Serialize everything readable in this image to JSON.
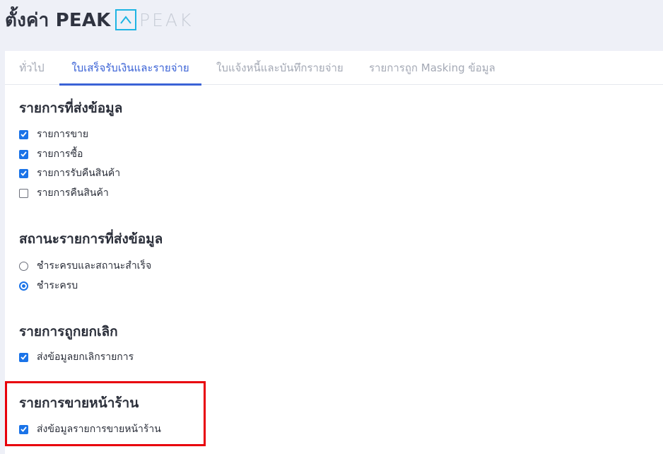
{
  "header": {
    "title": "ตั้งค่า PEAK",
    "logo_text": "PEAK",
    "logo_icon": "peak-logo-icon"
  },
  "tabs": [
    {
      "label": "ทั่วไป",
      "active": false
    },
    {
      "label": "ใบเสร็จรับเงินและรายจ่าย",
      "active": true
    },
    {
      "label": "ใบแจ้งหนี้และบันทึกรายจ่าย",
      "active": false
    },
    {
      "label": "รายการถูก Masking ข้อมูล",
      "active": false
    }
  ],
  "sections": {
    "send_items": {
      "title": "รายการที่ส่งข้อมูล",
      "options": [
        {
          "label": "รายการขาย",
          "checked": true
        },
        {
          "label": "รายการซื้อ",
          "checked": true
        },
        {
          "label": "รายการรับคืนสินค้า",
          "checked": true
        },
        {
          "label": "รายการคืนสินค้า",
          "checked": false
        }
      ]
    },
    "status": {
      "title": "สถานะรายการที่ส่งข้อมูล",
      "options": [
        {
          "label": "ชำระครบและสถานะสำเร็จ",
          "selected": false
        },
        {
          "label": "ชำระครบ",
          "selected": true
        }
      ]
    },
    "cancelled": {
      "title": "รายการถูกยกเลิก",
      "options": [
        {
          "label": "ส่งข้อมูลยกเลิกรายการ",
          "checked": true
        }
      ]
    },
    "storefront": {
      "title": "รายการขายหน้าร้าน",
      "options": [
        {
          "label": "ส่งข้อมูลรายการขายหน้าร้าน",
          "checked": true
        }
      ]
    }
  },
  "colors": {
    "accent": "#3b63d6",
    "checkbox": "#1a73e8",
    "highlight": "#e8000b",
    "logo": "#1fb4e3"
  }
}
